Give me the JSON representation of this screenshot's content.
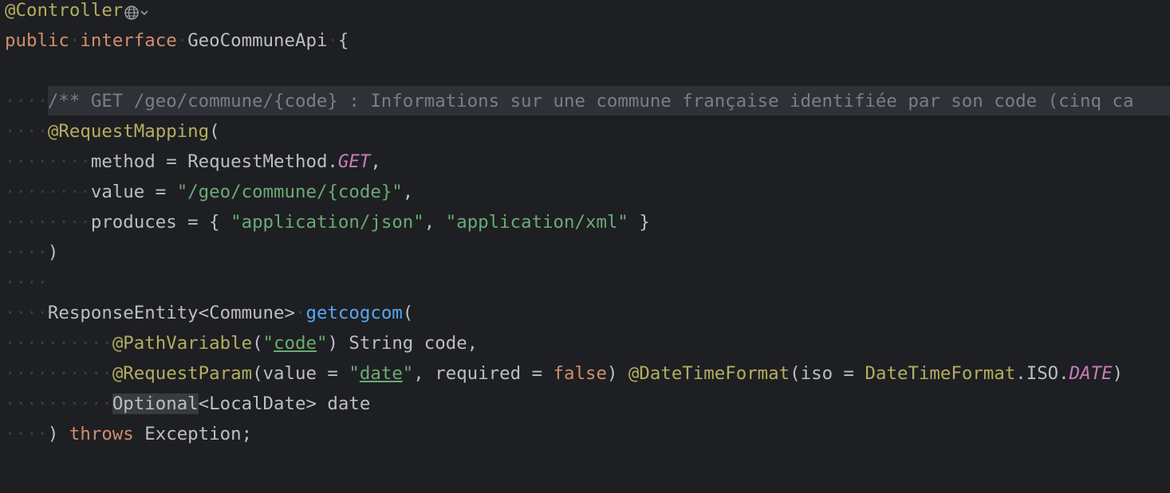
{
  "code": {
    "line1": {
      "annotation": "@Controller"
    },
    "line2": {
      "kw_public": "public",
      "kw_interface": "interface",
      "name": "GeoCommuneApi",
      "brace": "{"
    },
    "line4": {
      "doc": "/** GET /geo/commune/{code} : Informations sur une commune française identifiée par son code (cinq ca"
    },
    "line5": {
      "annotation": "@RequestMapping",
      "paren": "("
    },
    "line6": {
      "key": "method",
      "eq": " = ",
      "cls": "RequestMethod.",
      "const": "GET",
      "end": ","
    },
    "line7": {
      "key": "value",
      "eq": " = ",
      "str": "\"/geo/commune/{code}\"",
      "end": ","
    },
    "line8": {
      "key": "produces",
      "eq": " = ",
      "open": "{ ",
      "str1": "\"application/json\"",
      "comma": ", ",
      "str2": "\"application/xml\"",
      "close": " }"
    },
    "line9": {
      "paren": ")"
    },
    "line11": {
      "type": "ResponseEntity<Commune>",
      "method": "getcogcom",
      "paren": "("
    },
    "line12": {
      "annotation": "@PathVariable",
      "open": "(",
      "q1": "\"",
      "name": "code",
      "q2": "\"",
      "close": ")",
      "rest": " String code,"
    },
    "line13": {
      "annotation": "@RequestParam",
      "open": "(value = ",
      "q1": "\"",
      "name": "date",
      "q2": "\"",
      "mid": ", required = ",
      "kw_false": "false",
      "close": ") ",
      "annotation2": "@DateTimeFormat",
      "open2": "(iso = ",
      "cls": "DateTimeFormat",
      "dot": ".ISO.",
      "const": "DATE",
      "close2": ")"
    },
    "line14": {
      "highlight": "Optional",
      "rest": "<LocalDate> date"
    },
    "line15": {
      "paren": ") ",
      "kw_throws": "throws",
      "rest": " Exception;"
    }
  },
  "whitespace": {
    "indent4": "····",
    "indent8": "········",
    "indent9": "·········"
  },
  "icons": {
    "globe": "globe-icon",
    "chevron": "chevron-down-icon"
  },
  "colors": {
    "background": "#1e1f22",
    "annotation": "#b3ae60",
    "keyword": "#cf8e6d",
    "string": "#6aab73",
    "static_constant": "#c77dbb",
    "function": "#56a8f5",
    "doc_comment": "#7a7e85",
    "text": "#bcbec4"
  }
}
